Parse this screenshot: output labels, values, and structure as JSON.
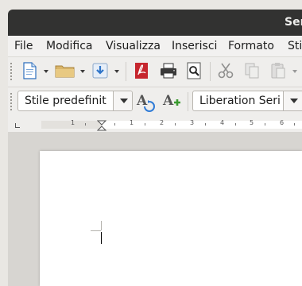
{
  "window": {
    "title": "Ser"
  },
  "menu": [
    "File",
    "Modifica",
    "Visualizza",
    "Inserisci",
    "Formato",
    "Sti"
  ],
  "toolbar1": {
    "icons": [
      "new-document-icon",
      "open-folder-icon",
      "save-icon",
      "export-pdf-icon",
      "print-icon",
      "print-preview-icon",
      "cut-icon",
      "copy-icon",
      "paste-icon"
    ]
  },
  "toolbar2": {
    "paragraph_style": "Stile predefinit",
    "font_name": "Liberation Seri"
  },
  "ruler": {
    "labels": [
      "1",
      "1",
      "2",
      "3",
      "4",
      "5",
      "6"
    ]
  },
  "colors": {
    "titlebar": "#323231",
    "menubar": "#f2f1f0",
    "toolbar": "#efeeec",
    "workspace": "#d7d5d1",
    "page": "#ffffff"
  }
}
